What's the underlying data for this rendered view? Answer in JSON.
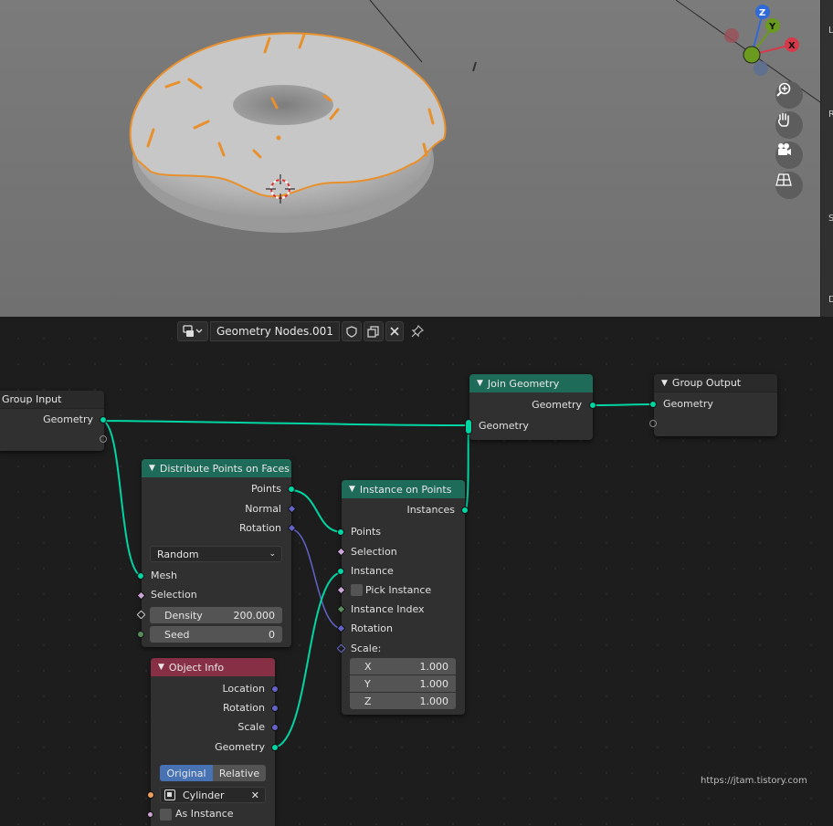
{
  "viewport": {
    "navigation_icons": [
      "zoom-icon",
      "pan-hand-icon",
      "camera-view-icon",
      "ortho-grid-icon"
    ],
    "gizmo": {
      "z": "Z",
      "y": "Y",
      "x": "X"
    },
    "side_letters": [
      "L",
      "R",
      "S",
      "D"
    ]
  },
  "node_editor": {
    "header": {
      "tree_name": "Geometry Nodes.001"
    },
    "nodes": {
      "group_input": {
        "title": "Group Input",
        "outputs": [
          "Geometry"
        ]
      },
      "join_geometry": {
        "title": "Join Geometry",
        "output": "Geometry",
        "input": "Geometry"
      },
      "group_output": {
        "title": "Group Output",
        "input": "Geometry"
      },
      "distribute": {
        "title": "Distribute Points on Faces",
        "outputs": [
          "Points",
          "Normal",
          "Rotation"
        ],
        "mode": "Random",
        "inputs": [
          "Mesh",
          "Selection"
        ],
        "density_label": "Density",
        "density_value": "200.000",
        "seed_label": "Seed",
        "seed_value": "0"
      },
      "instance_on_points": {
        "title": "Instance on Points",
        "output": "Instances",
        "inputs": [
          "Points",
          "Selection",
          "Instance",
          "Pick Instance",
          "Instance Index",
          "Rotation",
          "Scale:"
        ],
        "scale": [
          {
            "axis": "X",
            "value": "1.000"
          },
          {
            "axis": "Y",
            "value": "1.000"
          },
          {
            "axis": "Z",
            "value": "1.000"
          }
        ]
      },
      "object_info": {
        "title": "Object Info",
        "outputs": [
          "Location",
          "Rotation",
          "Scale",
          "Geometry"
        ],
        "transform_options": [
          "Original",
          "Relative"
        ],
        "selected_option": "Original",
        "object": "Cylinder",
        "as_instance": "As Instance"
      }
    }
  },
  "watermark": "https://jtam.tistory.com",
  "colors": {
    "geometry_socket": "#00d6a3",
    "vector_socket": "#6363c7",
    "green_header": "#1e6b5a",
    "red_header": "#873045",
    "selection_outline": "#e8902c"
  }
}
